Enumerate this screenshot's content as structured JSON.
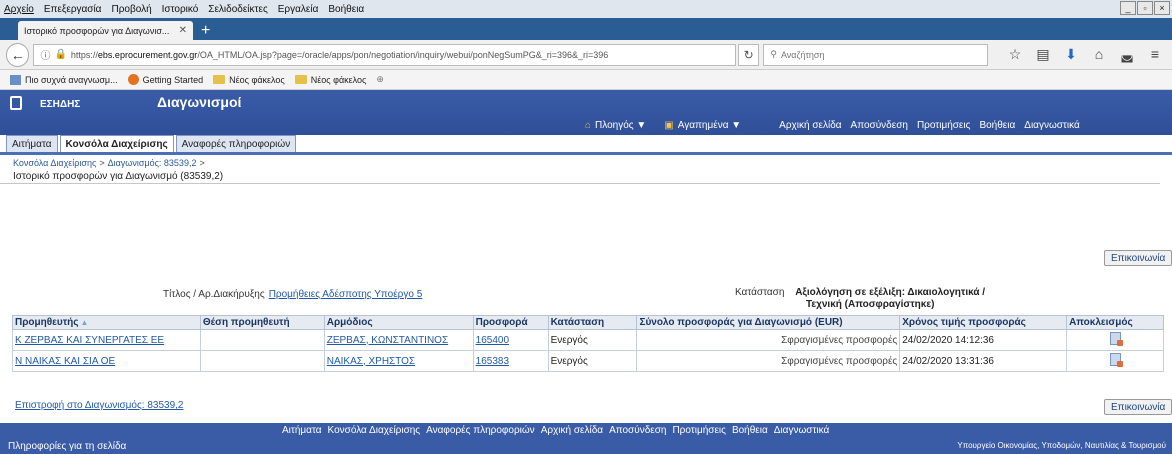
{
  "browser": {
    "menu": [
      "Αρχείο",
      "Επεξεργασία",
      "Προβολή",
      "Ιστορικό",
      "Σελιδοδείκτες",
      "Εργαλεία",
      "Βοήθεια"
    ],
    "tab_title": "Ιστορικό προσφορών για Διαγωνισ...",
    "url_prefix": "https://",
    "url_domain": "ebs.eprocurement.gov.gr",
    "url_rest": "/OA_HTML/OA.jsp?page=/oracle/apps/pon/negotiation/inquiry/webui/ponNegSumPG&_ri=396&_ri=396",
    "search_placeholder": "Αναζήτηση",
    "bookmarks": [
      {
        "label": "Πιο συχνά αναγνωσμ...",
        "icon": "most-visited-icon"
      },
      {
        "label": "Getting Started",
        "icon": "firefox-icon"
      },
      {
        "label": "Νέος φάκελος",
        "icon": "folder-icon"
      },
      {
        "label": "Νέος φάκελος",
        "icon": "folder-icon"
      }
    ]
  },
  "app": {
    "brand": "ΕΣΗΔΗΣ",
    "title": "Διαγωνισμοί",
    "global": {
      "nav": "Πλοηγός ▼",
      "favorites": "Αγαπημένα ▼",
      "links": [
        "Αρχική σελίδα",
        "Αποσύνδεση",
        "Προτιμήσεις",
        "Βοήθεια",
        "Διαγνωστικά"
      ]
    },
    "tabs": [
      "Αιτήματα",
      "Κονσόλα Διαχείρισης",
      "Αναφορές πληροφοριών"
    ],
    "crumbs": [
      "Κονσόλα Διαχείρισης",
      "Διαγωνισμός: 83539,2"
    ],
    "page_title": "Ιστορικό προσφορών για Διαγωνισμό (83539,2)",
    "contact": "Επικοινωνία",
    "title_label": "Τίτλος / Αρ.Διακήρυξης",
    "title_value": "Προμήθειες Αδέσποτης Υποέργο 5",
    "status_label": "Κατάσταση",
    "status_value_1": "Αξιολόγηση σε εξέλιξη: Δικαιολογητικά /",
    "status_value_2": "Τεχνική (Αποσφραγίστηκε)"
  },
  "table": {
    "headers": [
      "Προμηθευτής",
      "Θέση προμηθευτή",
      "Αρμόδιος",
      "Προσφορά",
      "Κατάσταση",
      "Σύνολο προσφοράς για Διαγωνισμό (EUR)",
      "Χρόνος τιμής προσφοράς",
      "Αποκλεισμός"
    ],
    "rows": [
      {
        "supplier": "Κ ΖΕΡΒΑΣ ΚΑΙ ΣΥΝΕΡΓΑΤΕΣ ΕΕ",
        "site": "",
        "contact": "ΖΕΡΒΑΣ, ΚΩΝΣΤΑΝΤΙΝΟΣ",
        "offer": "165400",
        "status": "Ενεργός",
        "total": "Σφραγισμένες προσφορές",
        "time": "24/02/2020 14:12:36"
      },
      {
        "supplier": "Ν ΝΑΙΚΑΣ ΚΑΙ ΣΙΑ ΟΕ",
        "site": "",
        "contact": "ΝΑΙΚΑΣ, ΧΡΗΣΤΟΣ",
        "offer": "165383",
        "status": "Ενεργός",
        "total": "Σφραγισμένες προσφορές",
        "time": "24/02/2020 13:31:36"
      }
    ]
  },
  "back_link": "Επιστροφή στο Διαγωνισμός: 83539,2",
  "footer": {
    "links": [
      "Αιτήματα",
      "Κονσόλα Διαχείρισης",
      "Αναφορές πληροφοριών",
      "Αρχική σελίδα",
      "Αποσύνδεση",
      "Προτιμήσεις",
      "Βοήθεια",
      "Διαγνωστικά"
    ],
    "left": "Πληροφορίες για τη σελίδα",
    "right": "Υπουργείο Οικονομίας, Υποδομών, Ναυτιλίας & Τουρισμού"
  }
}
